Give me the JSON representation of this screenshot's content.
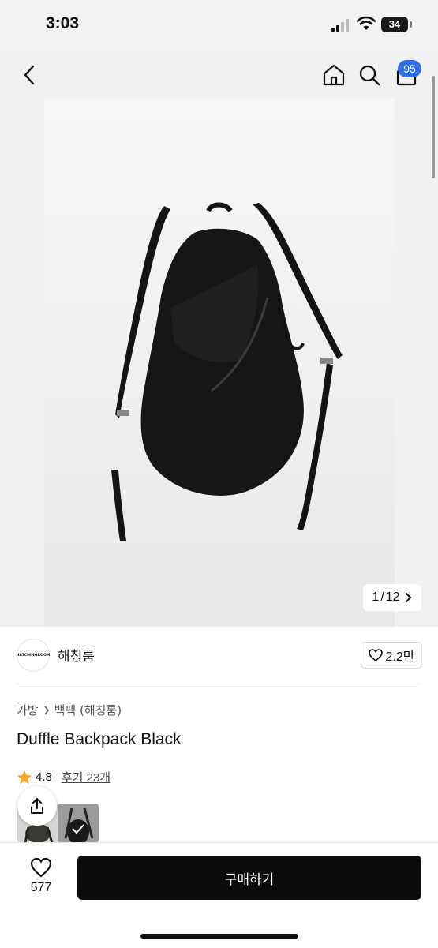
{
  "status_bar": {
    "time": "3:03",
    "battery": "34"
  },
  "header": {
    "cart_count": "95"
  },
  "gallery": {
    "current": "1",
    "total": "12",
    "separator": "/"
  },
  "seller": {
    "logo_text": "HATCHINGROOM",
    "name": "해칭룸",
    "likes": "2.2만"
  },
  "breadcrumb": [
    "가방",
    "백팩 (해칭룸)"
  ],
  "product": {
    "title": "Duffle Backpack Black"
  },
  "rating": {
    "score": "4.8",
    "reviews": "후기 23개"
  },
  "bottom_bar": {
    "wish_count": "577",
    "buy_label": "구매하기"
  },
  "icons": [
    "back-icon",
    "home-icon",
    "search-icon",
    "bag-icon",
    "heart-icon",
    "share-icon",
    "chevron-right-icon",
    "star-icon",
    "check-icon"
  ],
  "colors": {
    "badge": "#2f6fe4",
    "star": "#f5a623",
    "buy_button": "#0c0c0c"
  }
}
